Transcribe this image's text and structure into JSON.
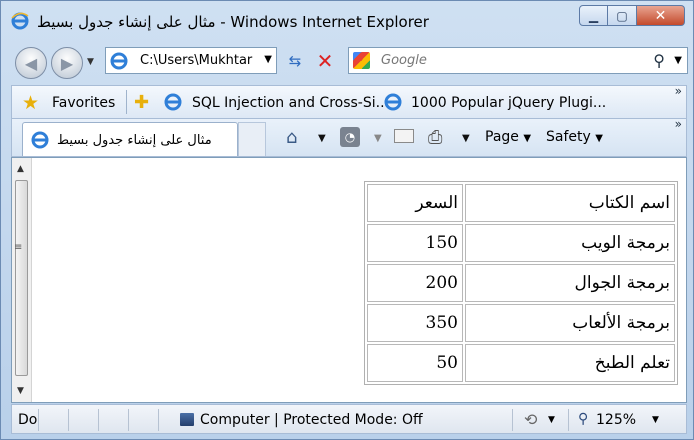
{
  "window": {
    "title": "مثال على إنشاء جدول بسيط - Windows Internet Explorer",
    "minimize_glyph": "▁",
    "maximize_glyph": "▢",
    "close_glyph": "✕"
  },
  "address_bar": {
    "url": "C:\\Users\\Mukhtar",
    "search_placeholder": "Google"
  },
  "favorites_bar": {
    "favorites_label": "Favorites",
    "links": [
      "SQL Injection and Cross-Si...",
      "1000 Popular jQuery Plugi..."
    ]
  },
  "tabs": [
    {
      "label": "مثال على إنشاء جدول بسيط"
    }
  ],
  "command_bar": {
    "page_label": "Page",
    "safety_label": "Safety"
  },
  "table": {
    "headers": [
      "اسم الكتاب",
      "السعر"
    ],
    "rows": [
      [
        "برمجة الويب",
        "150"
      ],
      [
        "برمجة الجوال",
        "200"
      ],
      [
        "برمجة الألعاب",
        "350"
      ],
      [
        "تعلم الطبخ",
        "50"
      ]
    ]
  },
  "status_bar": {
    "status_text": "Do",
    "zone_text": "Computer | Protected Mode: Off",
    "zoom": "125%"
  }
}
